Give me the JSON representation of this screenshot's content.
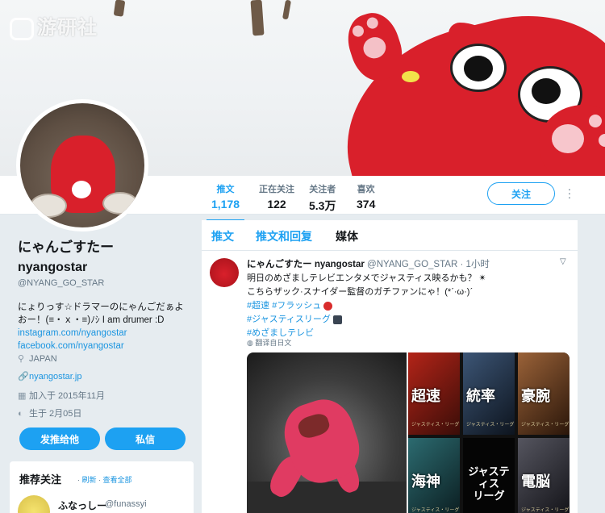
{
  "banner": {
    "watermark": "游研社"
  },
  "stats": [
    {
      "label": "推文",
      "value": "1,178",
      "active": true
    },
    {
      "label": "正在关注",
      "value": "122",
      "active": false
    },
    {
      "label": "关注者",
      "value": "5.3万",
      "active": false
    },
    {
      "label": "喜欢",
      "value": "374",
      "active": false
    }
  ],
  "header": {
    "follow_label": "关注"
  },
  "profile": {
    "name": "にゃんごすたー",
    "username_display": "nyangostar",
    "handle": "@NYANG_GO_STAR",
    "bio_line1": "にょりっす☆ドラマーのにゃんごだぁよ",
    "bio_line2": "おー！(≡・ｘ・≡)ﾉｼ I am drumer :D",
    "link1": "instagram.com/nyangostar",
    "link2": "facebook.com/nyangostar",
    "location": "JAPAN",
    "website": "nyangostar.jp",
    "joined": "加入于 2015年11月",
    "birthday": "生于 2月05日",
    "tweet_to_label": "发推给他",
    "message_label": "私信"
  },
  "recommend": {
    "title": "推荐关注",
    "refresh": "刷新",
    "view_all": "查看全部",
    "sep": " · ",
    "user_name": "ふなっしー",
    "user_handle": "@funassyi"
  },
  "timeline": {
    "tabs": [
      "推文",
      "推文和回复",
      "媒体"
    ],
    "tweet": {
      "name": "にゃんごすたー",
      "user": "nyangostar",
      "handle": "@NYANG_GO_STAR",
      "time": "· 1小时",
      "line1": "明日のめざましテレビエンタメでジャスティス映るかも？ ✴",
      "line2": "こちらザック·スナイダー監督のガチファンにゃ！(*ˊ·ω·)ˊ",
      "tag1": "#超速",
      "tag2": "#フラッシュ",
      "tag3": "#ジャスティスリーグ",
      "tag4": "#めざましテレビ",
      "translate": "翻译自日文"
    },
    "posters": [
      {
        "kanji": "超速",
        "color": "#8a1b14"
      },
      {
        "kanji": "統率",
        "color": "#2a3b52"
      },
      {
        "kanji": "豪腕",
        "color": "#7a4a2a"
      },
      {
        "kanji": "海神",
        "color": "#1f4a4e"
      },
      {
        "kanji": "電脳",
        "color": "#3d3d46"
      }
    ],
    "poster_small": "ジャスティス・リーグ",
    "poster_title": "ジャスティス\nリーグ"
  },
  "colors": {
    "accent": "#1da1f2",
    "link": "#1b95e0",
    "muted": "#657786",
    "mascot_red": "#d9202b"
  }
}
